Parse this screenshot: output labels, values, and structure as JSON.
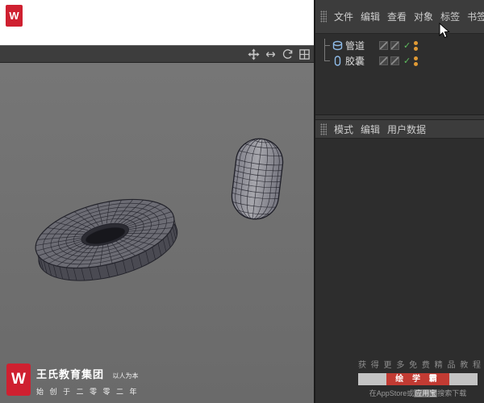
{
  "colors": {
    "brand_red": "#cf2030",
    "badge_red": "#c23b33",
    "check_green": "#5fbf5f",
    "visibility_dot_orange": "#e09a35",
    "object_icon_blue": "#8fbce9",
    "viewport_gray": "#717171"
  },
  "top_watermark": {
    "logo_letter": "W"
  },
  "viewport_toolbar": {
    "icons": [
      "pan",
      "zoom",
      "rotate",
      "maximize"
    ]
  },
  "object_manager": {
    "menu": [
      "文件",
      "编辑",
      "查看",
      "对象",
      "标签",
      "书签"
    ],
    "objects": [
      {
        "name": "管道",
        "enabled_check": "✓"
      },
      {
        "name": "胶囊",
        "enabled_check": "✓"
      }
    ]
  },
  "attribute_manager": {
    "menu": [
      "模式",
      "编辑",
      "用户数据"
    ]
  },
  "bottom_watermark": {
    "logo_letter": "W",
    "title": "王氏教育集团",
    "slogan": "以人为本",
    "since": "始 创 于 二 零 零 二 年"
  },
  "promo": {
    "line1": "获 得 更 多 免 费 精 品 教 程",
    "badge": "绘 学 霸",
    "line3_prefix": "在AppStore或",
    "line3_highlight": "应用宝",
    "line3_suffix": "搜索下载"
  }
}
